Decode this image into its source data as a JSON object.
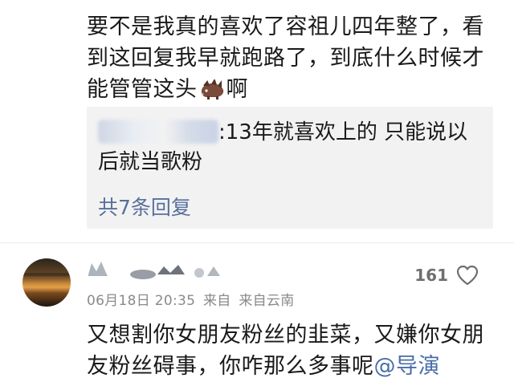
{
  "post": {
    "text_before_emoji": "要不是我真的喜欢了容祖儿四年整了，看到这回复我早就跑路了，到底什么时候才能管管这头",
    "emoji_icon": "boar-emoji-icon",
    "text_after_emoji": "啊"
  },
  "reply_preview": {
    "text": ":13年就喜欢上的 只能说以后就当歌粉",
    "reply_count_label": "共7条回复",
    "link_color": "#57709c"
  },
  "comment": {
    "date": "06月18日 20:35",
    "source_prefix": "来自",
    "source": "来自云南",
    "like_count": "161",
    "like_icon": "heart-outline-icon",
    "text": "又想割你女朋友粉丝的韭菜，又嫌你女朋友粉丝碍事，你咋那么多事呢",
    "mention": "@导演"
  }
}
